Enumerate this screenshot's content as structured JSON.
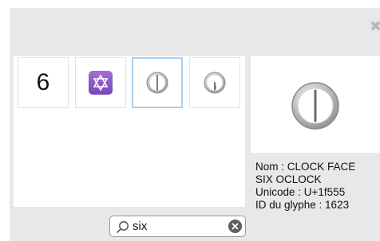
{
  "close": {
    "icon": "close-icon",
    "glyph": "✖"
  },
  "results": [
    {
      "glyph": "6",
      "icon": "digit-six",
      "selected": false
    },
    {
      "glyph": "",
      "icon": "six-pointed-star-icon",
      "selected": false
    },
    {
      "glyph": "",
      "icon": "clock-six-oclock-icon",
      "selected": true
    },
    {
      "glyph": "",
      "icon": "clock-six-thirty-icon",
      "selected": false
    }
  ],
  "preview": {
    "icon": "clock-six-oclock-icon"
  },
  "info": {
    "name_line1": "Nom : CLOCK FACE",
    "name_line2": "SIX OCLOCK",
    "unicode": "Unicode : U+1f555",
    "glyph_id": "ID du glyphe : 1623"
  },
  "search": {
    "value": "six",
    "search_icon": "search-icon",
    "clear_icon": "clear-icon"
  },
  "colors": {
    "panel_bg": "#e8e8e8",
    "selection_border": "#a9cff0",
    "star_tile": "#8a55c6",
    "clear_button": "#5f5f5f"
  }
}
